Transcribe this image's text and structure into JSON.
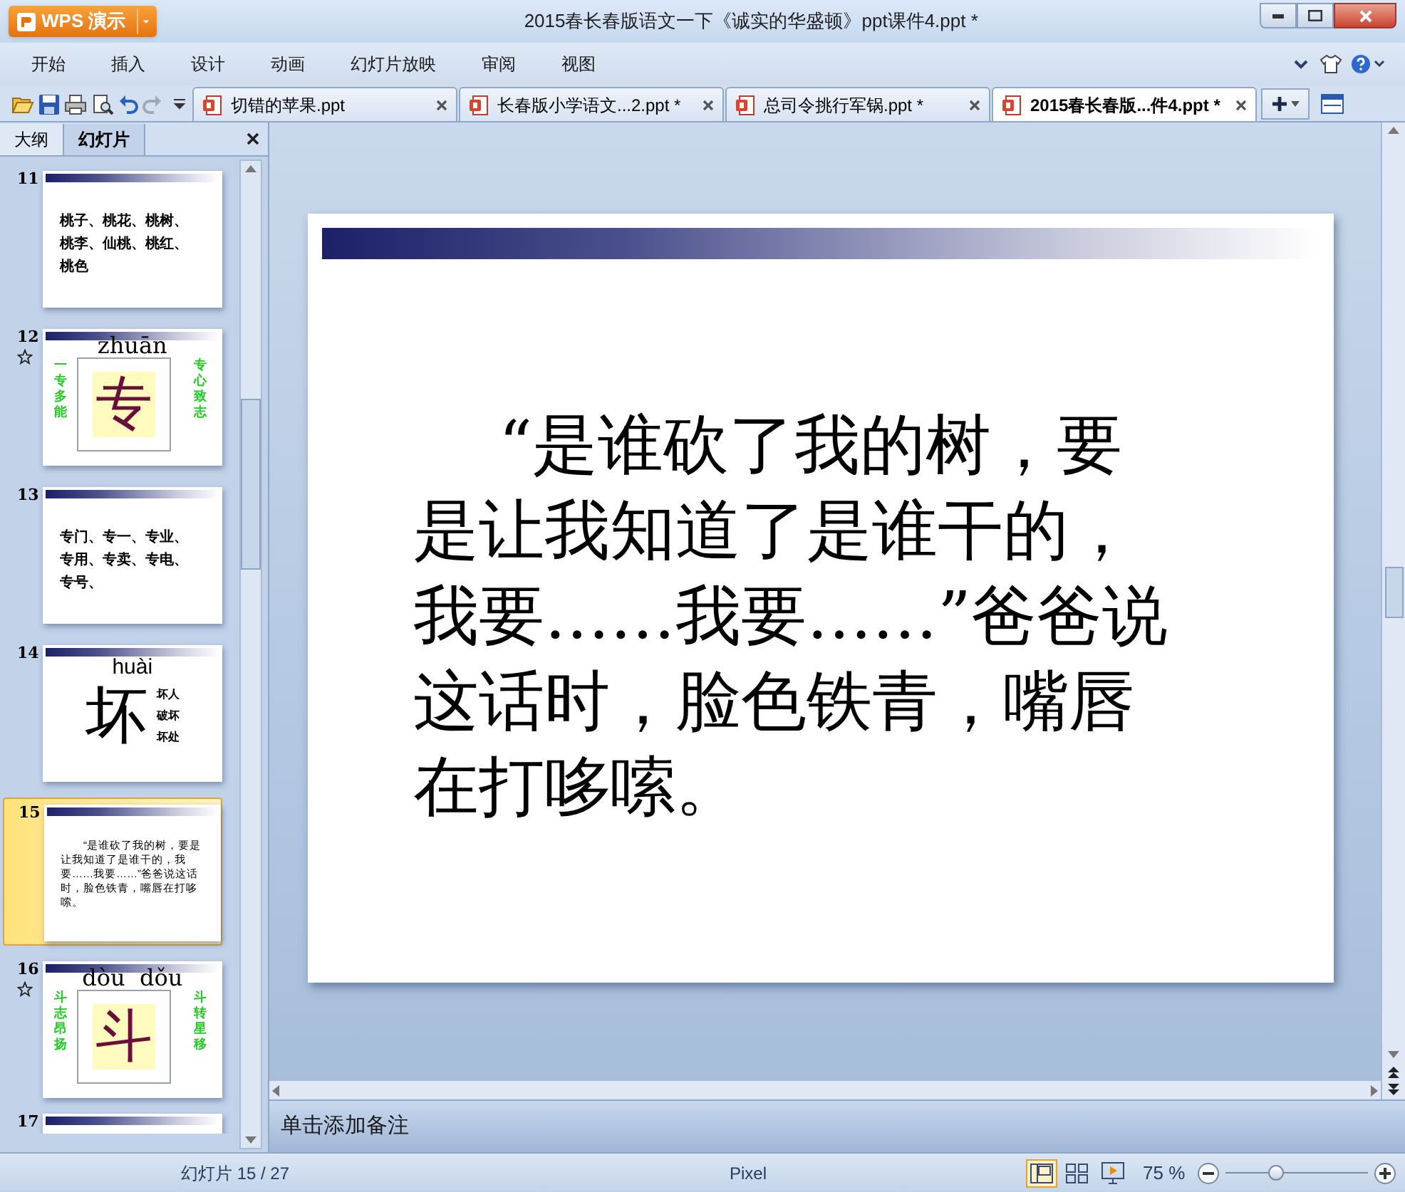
{
  "app_button": {
    "label": "WPS 演示"
  },
  "window": {
    "title": "2015春长春版语文一下《诚实的华盛顿》ppt课件4.ppt *"
  },
  "menu": [
    "开始",
    "插入",
    "设计",
    "动画",
    "幻灯片放映",
    "审阅",
    "视图"
  ],
  "doc_tabs": [
    {
      "label": "切错的苹果.ppt",
      "selected": false
    },
    {
      "label": "长春版小学语文...2.ppt *",
      "selected": false
    },
    {
      "label": "总司令挑行军锅.ppt *",
      "selected": false
    },
    {
      "label": "2015春长春版...件4.ppt *",
      "selected": true
    }
  ],
  "panel_tabs": [
    {
      "label": "大纲",
      "selected": false
    },
    {
      "label": "幻灯片",
      "selected": true
    }
  ],
  "thumbnails": [
    {
      "number": "11",
      "kind": "text",
      "selected": false,
      "animated": false,
      "lines": [
        "桃子、桃花、桃树、",
        "桃李、仙桃、桃红、",
        "桃色"
      ]
    },
    {
      "number": "12",
      "kind": "character",
      "selected": false,
      "animated": true,
      "pinyin": "zhuān",
      "character": "专",
      "left": "一专多能",
      "right": "专心致志"
    },
    {
      "number": "13",
      "kind": "text",
      "selected": false,
      "animated": false,
      "lines": [
        "专门、专一、专业、",
        "专用、专卖、专电、",
        "专号、"
      ]
    },
    {
      "number": "14",
      "kind": "word",
      "selected": false,
      "animated": false,
      "pinyin": "huài",
      "character": "坏",
      "words": [
        "坏人",
        "破坏",
        "坏处"
      ]
    },
    {
      "number": "15",
      "kind": "paragraph",
      "selected": true,
      "animated": false,
      "text": "“是谁砍了我的树，要是让我知道了是谁干的，我要……我要……”爸爸说这话时，脸色铁青，嘴唇在打哆嗦。"
    },
    {
      "number": "16",
      "kind": "character",
      "selected": false,
      "animated": true,
      "pinyin": "dòu  dǒu",
      "character": "斗",
      "left": "斗志昂扬",
      "right": "斗转星移"
    },
    {
      "number": "17",
      "kind": "blank",
      "selected": false,
      "animated": false
    }
  ],
  "slide": {
    "text": "“是谁砍了我的树，要是让我知道了是谁干的，我要……我要……”爸爸说这话时，脸色铁青，嘴唇在打哆嗦。"
  },
  "notes": {
    "placeholder": "单击添加备注"
  },
  "status_bar": {
    "slide_counter": "幻灯片 15 / 27",
    "theme": "Pixel",
    "views": [
      {
        "kind": "normal",
        "selected": true
      },
      {
        "kind": "sorter",
        "selected": false
      },
      {
        "kind": "show",
        "selected": false
      }
    ],
    "zoom": "75 %",
    "level": 0.35
  }
}
